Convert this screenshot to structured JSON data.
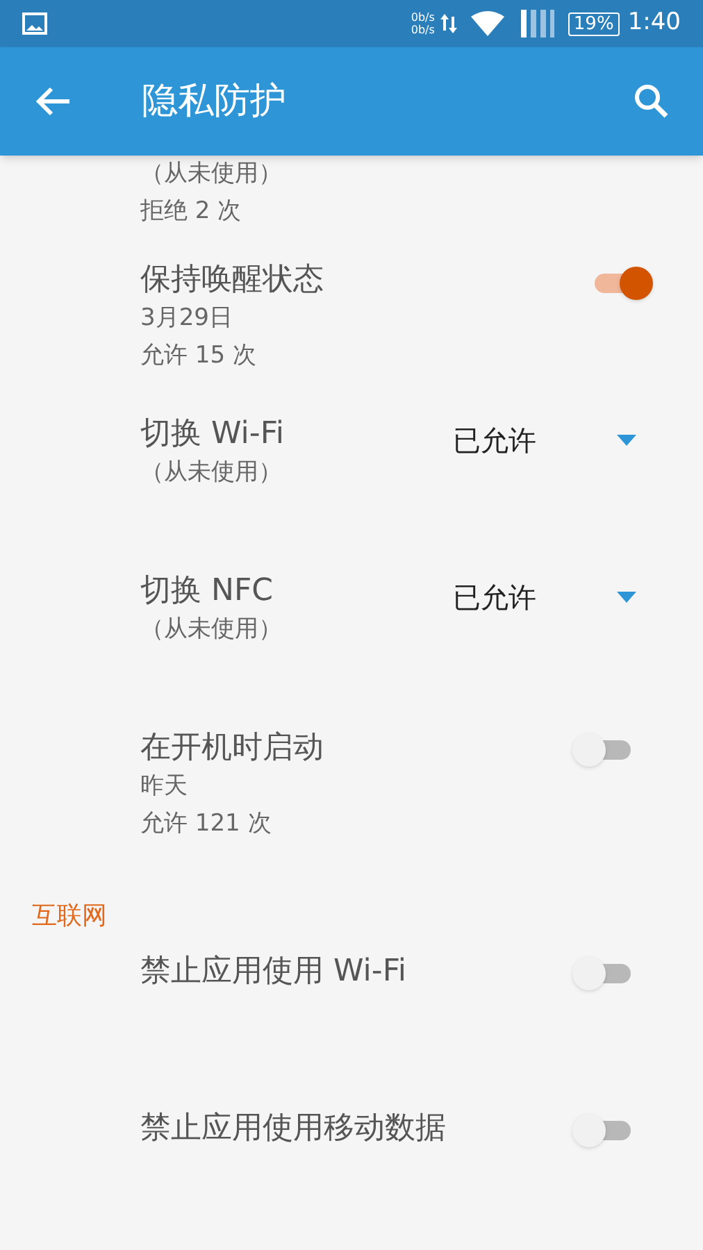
{
  "status_bar": {
    "speed_up": "0b/s",
    "speed_down": "0b/s",
    "battery": "19%",
    "time": "1:40"
  },
  "app_bar": {
    "title": "隐私防护"
  },
  "rows": [
    {
      "kind": "text",
      "lines": [
        "（从未使用）",
        "拒绝 2 次"
      ]
    },
    {
      "kind": "toggle",
      "title": "保持唤醒状态",
      "lines": [
        "3月29日",
        "允许 15 次"
      ],
      "on": true
    },
    {
      "kind": "dropdown",
      "title": "切换 Wi-Fi",
      "lines": [
        "（从未使用）"
      ],
      "value": "已允许"
    },
    {
      "kind": "dropdown",
      "title": "切换 NFC",
      "lines": [
        "（从未使用）"
      ],
      "value": "已允许"
    },
    {
      "kind": "toggle",
      "title": "在开机时启动",
      "lines": [
        "昨天",
        "允许 121 次"
      ],
      "on": false
    },
    {
      "kind": "section",
      "title": "互联网"
    },
    {
      "kind": "toggle",
      "title": "禁止应用使用 Wi-Fi",
      "on": false
    },
    {
      "kind": "toggle",
      "title": "禁止应用使用移动数据",
      "on": false
    }
  ]
}
